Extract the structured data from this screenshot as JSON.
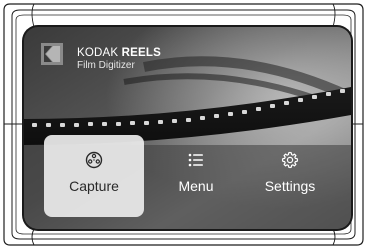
{
  "brand": {
    "name_part1": "KODAK",
    "name_part2": "REELS",
    "subtitle": "Film Digitizer",
    "logo_icon": "kodak-logo"
  },
  "menu": {
    "selected": "Capture",
    "items": [
      {
        "label": "Capture",
        "icon": "film-reel-icon"
      },
      {
        "label": "Menu",
        "icon": "list-icon"
      },
      {
        "label": "Settings",
        "icon": "gear-icon"
      }
    ]
  },
  "colors": {
    "screen_background": "#2b2b2b",
    "selected_tile": "#ebebeb",
    "logo_red": "#e4322b",
    "text_light": "#ffffff"
  }
}
